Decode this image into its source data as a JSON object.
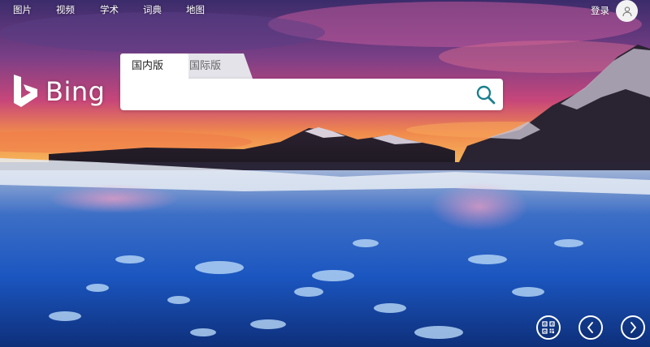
{
  "nav": {
    "items": [
      {
        "label": "图片"
      },
      {
        "label": "视频"
      },
      {
        "label": "学术"
      },
      {
        "label": "词典"
      },
      {
        "label": "地图"
      }
    ],
    "login_label": "登录"
  },
  "logo": {
    "text": "Bing"
  },
  "search": {
    "tabs": [
      {
        "label": "国内版",
        "active": true
      },
      {
        "label": "国际版",
        "active": false
      }
    ],
    "value": "",
    "accent": "#1a7f8e"
  },
  "icons": {
    "search": "search-icon",
    "avatar": "user-icon",
    "qr": "qr-code-icon",
    "prev": "chevron-left-icon",
    "next": "chevron-right-icon",
    "logo": "bing-logo-icon"
  }
}
